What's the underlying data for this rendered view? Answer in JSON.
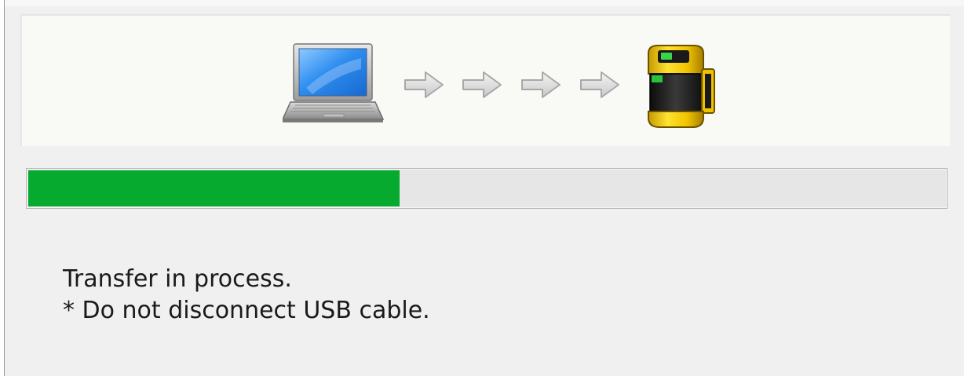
{
  "dialog": {
    "illustration": {
      "source_icon": "laptop-icon",
      "flow_icon": "arrow-right-icon",
      "flow_count": 4,
      "target_icon": "safety-scanner-device-icon"
    },
    "progress": {
      "fraction": 0.405,
      "fill_color": "#06aa2e",
      "track_color": "#e6e6e6"
    },
    "status_text": "Transfer in process.",
    "warning_text": "* Do not disconnect USB cable."
  }
}
